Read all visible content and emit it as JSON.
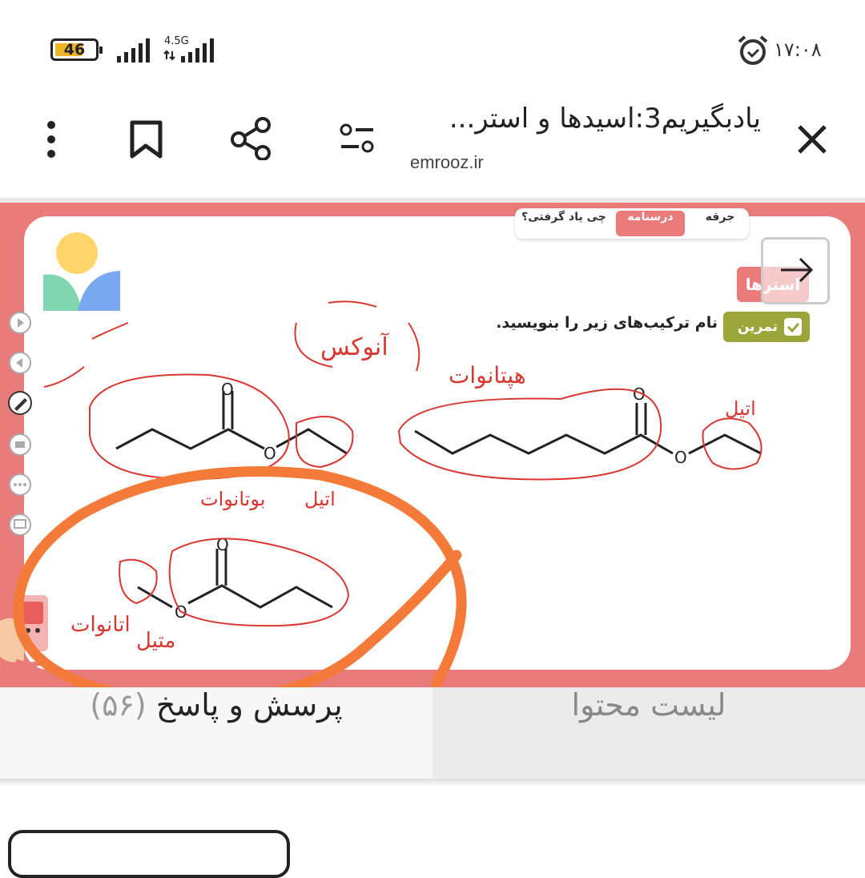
{
  "status_bar": {
    "battery_level": "46",
    "network_type": "4.5G",
    "time": "۱۷:۰۸",
    "icons": [
      "battery-icon",
      "signal-icon",
      "signal-icon",
      "alarm-icon"
    ]
  },
  "header": {
    "title": "یادبگیریم3:اسیدها و استر...",
    "domain": "emrooz.ir",
    "icons": [
      "close-icon",
      "settings-sliders-icon",
      "share-icon",
      "bookmark-icon",
      "more-vertical-icon"
    ]
  },
  "lesson": {
    "tabs": [
      "جرقه",
      "درسنامه",
      "چی یاد گرفتی؟"
    ],
    "active_tab": "درسنامه",
    "topic_tag": "استرها",
    "exercise_label": "تمرین",
    "instruction": "نام ترکیب‌های زیر را بنویسید.",
    "atom_label": "O",
    "handwritten_notes": [
      "بوتانوات",
      "اتیل",
      "هپتانوات",
      "اتیل",
      "متیل",
      "اتانوات",
      "آنوکس"
    ]
  },
  "colors": {
    "accent_pink": "#ea7b7b",
    "exercise_green": "#9aa53a",
    "annotation_red": "#d9362f",
    "highlight_orange": "#f47a3a"
  },
  "bottom_tabs": {
    "qa_label": "پرسش و پاسخ",
    "qa_count": "(۵۶)",
    "content_label": "لیست محتوا"
  }
}
